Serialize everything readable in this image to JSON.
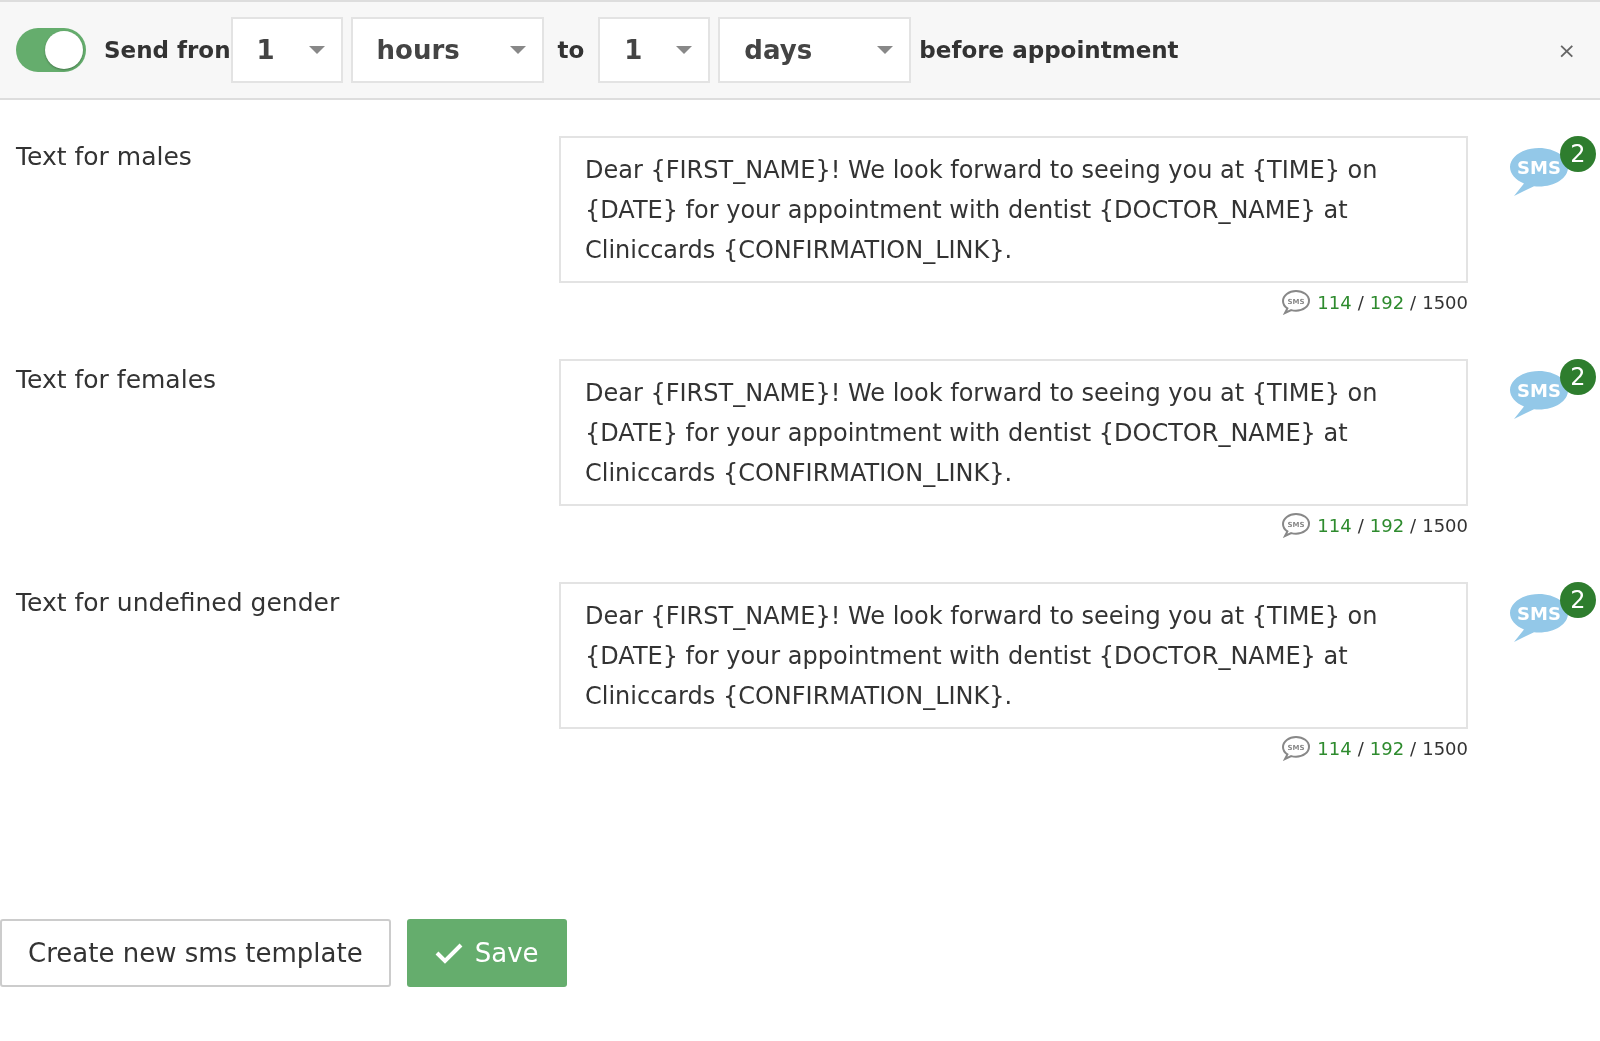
{
  "header": {
    "toggle": {
      "on": true
    },
    "send_label": "Send fron",
    "from_value": "1",
    "from_unit": "hours",
    "to_label": "to",
    "to_value": "1",
    "to_unit": "days",
    "suffix": "before appointment",
    "close": "×"
  },
  "templates": [
    {
      "label": "Text for males",
      "text": "Dear {FIRST_NAME}! We look forward to seeing you at {TIME} on {DATE} for your appointment with dentist {DOCTOR_NAME} at Cliniccards {CONFIRMATION_LINK}.",
      "icon_text": "SMS",
      "badge": "2",
      "counter_icon_text": "SMS",
      "chars": "114",
      "separator_1": "/",
      "limit": "192",
      "separator_2": "/",
      "max": "1500"
    },
    {
      "label": "Text for females",
      "text": "Dear {FIRST_NAME}! We look forward to seeing you at {TIME} on {DATE} for your appointment with dentist {DOCTOR_NAME} at Cliniccards {CONFIRMATION_LINK}.",
      "icon_text": "SMS",
      "badge": "2",
      "counter_icon_text": "SMS",
      "chars": "114",
      "separator_1": "/",
      "limit": "192",
      "separator_2": "/",
      "max": "1500"
    },
    {
      "label": "Text for undefined gender",
      "text": "Dear {FIRST_NAME}! We look forward to seeing you at {TIME} on {DATE} for your appointment with dentist {DOCTOR_NAME} at Cliniccards {CONFIRMATION_LINK}.",
      "icon_text": "SMS",
      "badge": "2",
      "counter_icon_text": "SMS",
      "chars": "114",
      "separator_1": "/",
      "limit": "192",
      "separator_2": "/",
      "max": "1500"
    }
  ],
  "buttons": {
    "create": "Create new sms template",
    "save": "Save"
  }
}
